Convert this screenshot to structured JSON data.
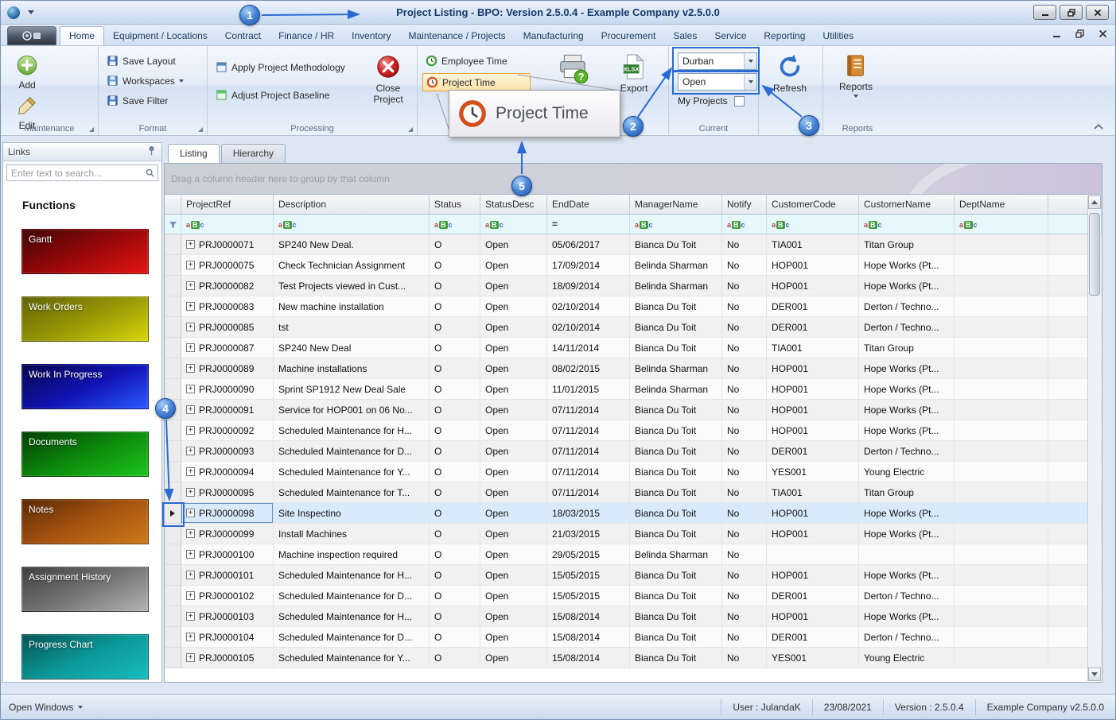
{
  "titlebar": {
    "title": "Project Listing - BPO: Version 2.5.0.4 - Example Company v2.5.0.0"
  },
  "ribbon": {
    "tabs": [
      "Home",
      "Equipment / Locations",
      "Contract",
      "Finance / HR",
      "Inventory",
      "Maintenance / Projects",
      "Manufacturing",
      "Procurement",
      "Sales",
      "Service",
      "Reporting",
      "Utilities"
    ],
    "active_tab_index": 0,
    "maintenance": {
      "label": "Maintenance",
      "add": "Add",
      "edit": "Edit"
    },
    "format": {
      "label": "Format",
      "save_layout": "Save Layout",
      "workspaces": "Workspaces",
      "save_filter": "Save Filter"
    },
    "processing": {
      "label": "Processing",
      "apply": "Apply Project Methodology",
      "adjust": "Adjust Project Baseline",
      "close_project": "Close Project"
    },
    "time": {
      "employee_time": "Employee Time",
      "project_time": "Project Time"
    },
    "export_label": "Export",
    "current": {
      "label": "Current",
      "site_value": "Durban",
      "status_value": "Open",
      "my_projects": "My Projects"
    },
    "refresh_label": "Refresh",
    "reports": {
      "label": "Reports",
      "button": "Reports"
    }
  },
  "sidebar": {
    "header": "Links",
    "search_placeholder": "Enter text to search...",
    "section_title": "Functions",
    "functions": [
      {
        "label": "Gantt",
        "from": "#400606",
        "mid": "#9a0808",
        "to": "#e41414"
      },
      {
        "label": "Work Orders",
        "from": "#64640a",
        "mid": "#989805",
        "to": "#d6d60e"
      },
      {
        "label": "Work In Progress",
        "from": "#06064a",
        "mid": "#1212b4",
        "to": "#2a5aff"
      },
      {
        "label": "Documents",
        "from": "#063f06",
        "mid": "#0c8c0c",
        "to": "#1ec41e"
      },
      {
        "label": "Notes",
        "from": "#5a2a06",
        "mid": "#a85410",
        "to": "#cc7a1a"
      },
      {
        "label": "Assignment History",
        "from": "#3f3f3f",
        "mid": "#757575",
        "to": "#b4b4b4"
      },
      {
        "label": "Progress Chart",
        "from": "#065454",
        "mid": "#0c9a9a",
        "to": "#18bcbc"
      }
    ]
  },
  "main": {
    "tabs": [
      "Listing",
      "Hierarchy"
    ],
    "active_tab_index": 0,
    "groupby_hint": "Drag a column header here to group by that column",
    "grid": {
      "columns": [
        {
          "label": "ProjectRef",
          "filter": "aBc"
        },
        {
          "label": "Description",
          "filter": "aBc"
        },
        {
          "label": "Status",
          "filter": "aBc"
        },
        {
          "label": "StatusDesc",
          "filter": "aBc"
        },
        {
          "label": "EndDate",
          "filter": "="
        },
        {
          "label": "ManagerName",
          "filter": "aBc"
        },
        {
          "label": "Notify",
          "filter": "aBc"
        },
        {
          "label": "CustomerCode",
          "filter": "aBc"
        },
        {
          "label": "CustomerName",
          "filter": "aBc"
        },
        {
          "label": "DeptName",
          "filter": "aBc"
        }
      ],
      "selected_row_index": 13,
      "rows": [
        [
          "PRJ0000071",
          "SP240 New Deal.",
          "O",
          "Open",
          "05/06/2017",
          "Bianca Du Toit",
          "No",
          "TIA001",
          "Titan Group",
          ""
        ],
        [
          "PRJ0000075",
          "Check Technician Assignment",
          "O",
          "Open",
          "17/09/2014",
          "Belinda Sharman",
          "No",
          "HOP001",
          "Hope Works (Pt...",
          ""
        ],
        [
          "PRJ0000082",
          "Test Projects viewed in Cust...",
          "O",
          "Open",
          "18/09/2014",
          "Belinda Sharman",
          "No",
          "HOP001",
          "Hope Works (Pt...",
          ""
        ],
        [
          "PRJ0000083",
          "New machine installation",
          "O",
          "Open",
          "02/10/2014",
          "Bianca Du Toit",
          "No",
          "DER001",
          "Derton / Techno...",
          ""
        ],
        [
          "PRJ0000085",
          "tst",
          "O",
          "Open",
          "02/10/2014",
          "Bianca Du Toit",
          "No",
          "DER001",
          "Derton / Techno...",
          ""
        ],
        [
          "PRJ0000087",
          "SP240 New Deal",
          "O",
          "Open",
          "14/11/2014",
          "Bianca Du Toit",
          "No",
          "TIA001",
          "Titan Group",
          ""
        ],
        [
          "PRJ0000089",
          "Machine installations",
          "O",
          "Open",
          "08/02/2015",
          "Belinda Sharman",
          "No",
          "HOP001",
          "Hope Works (Pt...",
          ""
        ],
        [
          "PRJ0000090",
          "Sprint SP1912 New Deal Sale",
          "O",
          "Open",
          "11/01/2015",
          "Belinda Sharman",
          "No",
          "HOP001",
          "Hope Works (Pt...",
          ""
        ],
        [
          "PRJ0000091",
          "Service for HOP001 on 06 No...",
          "O",
          "Open",
          "07/11/2014",
          "Bianca Du Toit",
          "No",
          "HOP001",
          "Hope Works (Pt...",
          ""
        ],
        [
          "PRJ0000092",
          "Scheduled Maintenance for H...",
          "O",
          "Open",
          "07/11/2014",
          "Bianca Du Toit",
          "No",
          "HOP001",
          "Hope Works (Pt...",
          ""
        ],
        [
          "PRJ0000093",
          "Scheduled Maintenance for D...",
          "O",
          "Open",
          "07/11/2014",
          "Bianca Du Toit",
          "No",
          "DER001",
          "Derton / Techno...",
          ""
        ],
        [
          "PRJ0000094",
          "Scheduled Maintenance for Y...",
          "O",
          "Open",
          "07/11/2014",
          "Bianca Du Toit",
          "No",
          "YES001",
          "Young Electric",
          ""
        ],
        [
          "PRJ0000095",
          "Scheduled Maintenance for T...",
          "O",
          "Open",
          "07/11/2014",
          "Bianca Du Toit",
          "No",
          "TIA001",
          "Titan Group",
          ""
        ],
        [
          "PRJ0000098",
          "Site Inspectino",
          "O",
          "Open",
          "18/03/2015",
          "Bianca Du Toit",
          "No",
          "HOP001",
          "Hope Works (Pt...",
          ""
        ],
        [
          "PRJ0000099",
          "Install Machines",
          "O",
          "Open",
          "21/03/2015",
          "Bianca Du Toit",
          "No",
          "HOP001",
          "Hope Works (Pt...",
          ""
        ],
        [
          "PRJ0000100",
          "Machine inspection required",
          "O",
          "Open",
          "29/05/2015",
          "Belinda Sharman",
          "No",
          "",
          "",
          ""
        ],
        [
          "PRJ0000101",
          "Scheduled Maintenance for H...",
          "O",
          "Open",
          "15/05/2015",
          "Bianca Du Toit",
          "No",
          "HOP001",
          "Hope Works (Pt...",
          ""
        ],
        [
          "PRJ0000102",
          "Scheduled Maintenance for D...",
          "O",
          "Open",
          "15/05/2015",
          "Bianca Du Toit",
          "No",
          "DER001",
          "Derton / Techno...",
          ""
        ],
        [
          "PRJ0000103",
          "Scheduled Maintenance for H...",
          "O",
          "Open",
          "15/08/2014",
          "Bianca Du Toit",
          "No",
          "HOP001",
          "Hope Works (Pt...",
          ""
        ],
        [
          "PRJ0000104",
          "Scheduled Maintenance for D...",
          "O",
          "Open",
          "15/08/2014",
          "Bianca Du Toit",
          "No",
          "DER001",
          "Derton / Techno...",
          ""
        ],
        [
          "PRJ0000105",
          "Scheduled Maintenance for Y...",
          "O",
          "Open",
          "15/08/2014",
          "Bianca Du Toit",
          "No",
          "YES001",
          "Young Electric",
          ""
        ]
      ]
    }
  },
  "statusbar": {
    "open_windows": "Open Windows",
    "user": "User : JulandaK",
    "date": "23/08/2021",
    "version": "Version : 2.5.0.4",
    "company": "Example Company v2.5.0.0"
  },
  "annotations": {
    "badges": [
      "1",
      "2",
      "3",
      "4",
      "5"
    ],
    "magnifier_label": "Project Time",
    "accent": "#2a6bd4"
  },
  "icons": {
    "expand": "+",
    "filter_abc": [
      "a",
      "B",
      "c"
    ],
    "filter_eq": "="
  }
}
